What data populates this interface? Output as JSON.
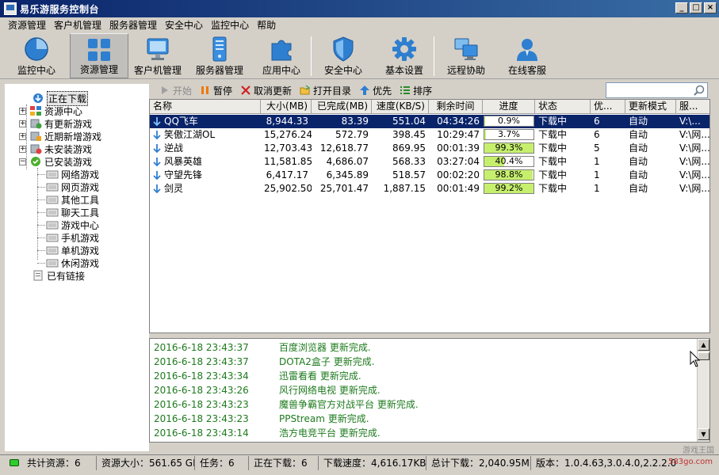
{
  "window": {
    "title": "易乐游服务控制台",
    "btn_min": "_",
    "btn_max": "□",
    "btn_close": "×"
  },
  "menu": [
    "资源管理",
    "客户机管理",
    "服务器管理",
    "安全中心",
    "监控中心",
    "帮助"
  ],
  "toolbar": [
    {
      "label": "监控中心",
      "icon": "pie-chart-icon"
    },
    {
      "label": "资源管理",
      "icon": "grid-icon",
      "active": true
    },
    {
      "label": "客户机管理",
      "icon": "monitor-icon"
    },
    {
      "label": "服务器管理",
      "icon": "server-icon"
    },
    {
      "label": "应用中心",
      "icon": "puzzle-icon"
    },
    {
      "label": "安全中心",
      "icon": "shield-icon"
    },
    {
      "label": "基本设置",
      "icon": "gear-icon"
    },
    {
      "label": "远程协助",
      "icon": "remote-icon"
    },
    {
      "label": "在线客服",
      "icon": "user-icon"
    }
  ],
  "tree": {
    "downloading": "正在下载",
    "resource_center": "资源中心",
    "has_update": "有更新游戏",
    "recent_new": "近期新增游戏",
    "not_installed": "未安装游戏",
    "installed": "已安装游戏",
    "installed_children": [
      "网络游戏",
      "网页游戏",
      "其他工具",
      "聊天工具",
      "游戏中心",
      "手机游戏",
      "单机游戏",
      "休闲游戏"
    ],
    "existing_links": "已有链接"
  },
  "actions": {
    "start": "开始",
    "pause": "暂停",
    "cancel": "取消更新",
    "open_dir": "打开目录",
    "priority": "优先",
    "sort": "排序"
  },
  "search": {
    "placeholder": ""
  },
  "table": {
    "columns": [
      "名称",
      "大小(MB)",
      "已完成(MB)",
      "速度(KB/S)",
      "剩余时间",
      "进度",
      "状态",
      "优...",
      "更新模式",
      "服..."
    ],
    "rows": [
      {
        "name": "QQ飞车",
        "size": "8,944.33",
        "done": "83.39",
        "speed": "551.04",
        "remain": "04:34:26",
        "progress": "0.9%",
        "pct": 0.9,
        "status": "下载中",
        "prio": "6",
        "mode": "自动",
        "server": "V:\\..."
      },
      {
        "name": "笑傲江湖OL",
        "size": "15,276.24",
        "done": "572.79",
        "speed": "398.45",
        "remain": "10:29:47",
        "progress": "3.7%",
        "pct": 3.7,
        "status": "下载中",
        "prio": "6",
        "mode": "自动",
        "server": "V:\\网..."
      },
      {
        "name": "逆战",
        "size": "12,703.43",
        "done": "12,618.77",
        "speed": "869.95",
        "remain": "00:01:39",
        "progress": "99.3%",
        "pct": 99.3,
        "status": "下载中",
        "prio": "5",
        "mode": "自动",
        "server": "V:\\网..."
      },
      {
        "name": "风暴英雄",
        "size": "11,581.85",
        "done": "4,686.07",
        "speed": "568.33",
        "remain": "03:27:04",
        "progress": "40.4%",
        "pct": 40.4,
        "status": "下载中",
        "prio": "1",
        "mode": "自动",
        "server": "V:\\网..."
      },
      {
        "name": "守望先锋",
        "size": "6,417.17",
        "done": "6,345.89",
        "speed": "518.57",
        "remain": "00:02:20",
        "progress": "98.8%",
        "pct": 98.8,
        "status": "下载中",
        "prio": "1",
        "mode": "自动",
        "server": "V:\\网..."
      },
      {
        "name": "剑灵",
        "size": "25,902.50",
        "done": "25,701.47",
        "speed": "1,887.15",
        "remain": "00:01:49",
        "progress": "99.2%",
        "pct": 99.2,
        "status": "下载中",
        "prio": "1",
        "mode": "自动",
        "server": "V:\\网..."
      }
    ]
  },
  "log": [
    {
      "time": "2016-6-18 23:43:37",
      "msg": "百度浏览器 更新完成."
    },
    {
      "time": "2016-6-18 23:43:37",
      "msg": "DOTA2盒子 更新完成."
    },
    {
      "time": "2016-6-18 23:43:34",
      "msg": "迅雷看看 更新完成."
    },
    {
      "time": "2016-6-18 23:43:26",
      "msg": "风行网络电视 更新完成."
    },
    {
      "time": "2016-6-18 23:43:23",
      "msg": "魔兽争霸官方对战平台 更新完成."
    },
    {
      "time": "2016-6-18 23:43:23",
      "msg": "PPStream 更新完成."
    },
    {
      "time": "2016-6-18 23:43:14",
      "msg": "浩方电竞平台 更新完成."
    }
  ],
  "status": {
    "total": "共计资源：6",
    "size": "资源大小：561.65 GB",
    "tasks": "任务：6",
    "downloading": "正在下载：6",
    "speed": "下载速度：4,616.17KB/S",
    "total_dl": "总计下载：2,040.95MB",
    "version": "版本：1.0.4.63,3.0.4.0,2.2.2.0"
  },
  "watermark": {
    "site": "583go.com",
    "brand": "游戏王国"
  },
  "colors": {
    "accent": "#0a246a",
    "log_text": "#1d7a1d",
    "progress_fill": "#c6ef6e"
  }
}
